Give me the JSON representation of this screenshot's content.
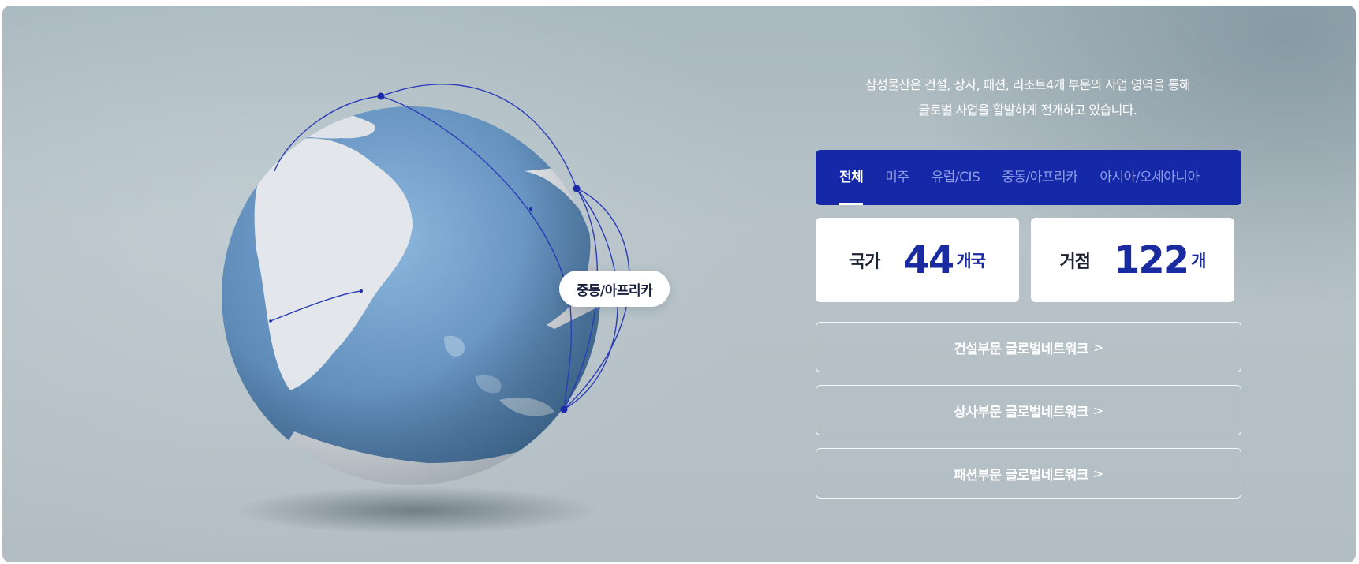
{
  "intro": {
    "line1": "삼성물산은 건설, 상사, 패션, 리조트4개 부문의 사업 영역을 통해",
    "line2": "글로벌 사업을 활발하게 전개하고 있습니다."
  },
  "tabs": [
    {
      "label": "전체",
      "active": true
    },
    {
      "label": "미주",
      "active": false
    },
    {
      "label": "유럽/CIS",
      "active": false
    },
    {
      "label": "중동/아프리카",
      "active": false
    },
    {
      "label": "아시아/오세아니아",
      "active": false
    }
  ],
  "globe": {
    "hover_label": "중동/아프리카"
  },
  "stats": {
    "countries": {
      "label": "국가",
      "value": "44",
      "unit": "개국"
    },
    "sites": {
      "label": "거점",
      "value": "122",
      "unit": "개"
    }
  },
  "links": [
    {
      "label": "건설부문 글로벌네트워크",
      "chevron": ">"
    },
    {
      "label": "상사부문 글로벌네트워크",
      "chevron": ">"
    },
    {
      "label": "패션부문 글로벌네트워크",
      "chevron": ">"
    }
  ],
  "colors": {
    "accent": "#1529a8",
    "tab_inactive": "#8f9ce8",
    "stat_value": "#1a2aa0",
    "ocean": "#6b98c4",
    "land": "#e3e6ea"
  }
}
